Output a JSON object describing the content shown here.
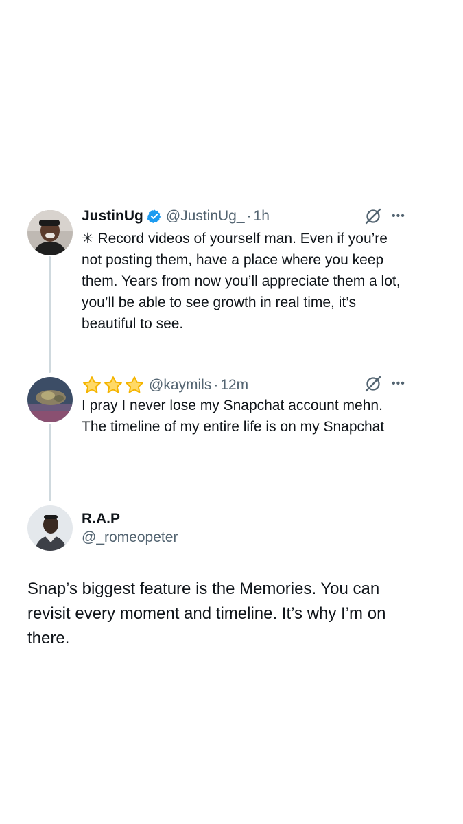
{
  "tweets": [
    {
      "name": "JustinUg",
      "handle": "@JustinUg_",
      "separator": "·",
      "time": "1h",
      "text": "✳ Record videos of yourself man. Even if you’re not posting them, have a place where you keep them. Years from now you’ll appreciate them a lot, you’ll be able to see growth in real time, it’s beautiful to see."
    },
    {
      "handle": "@kaymils",
      "separator": "·",
      "time": "12m",
      "text": "I pray I never lose my Snapchat account mehn. The timeline of my entire life is on my Snapchat"
    }
  ],
  "reply": {
    "name": "R.A.P",
    "handle": "@_romeopeter",
    "text": "Snap’s biggest feature is the Memories. You can revisit every moment and timeline. It’s why I’m on there."
  },
  "icons": {
    "verified": "verified-badge-icon",
    "grok": "grok-icon",
    "more": "more-options-icon",
    "star": "star-icon"
  },
  "colors": {
    "verified": "#1d9bf0",
    "star_stroke": "#f4b400",
    "star_fill": "#ffd966",
    "secondary_text": "#536471",
    "thread_line": "#cfd9de"
  }
}
